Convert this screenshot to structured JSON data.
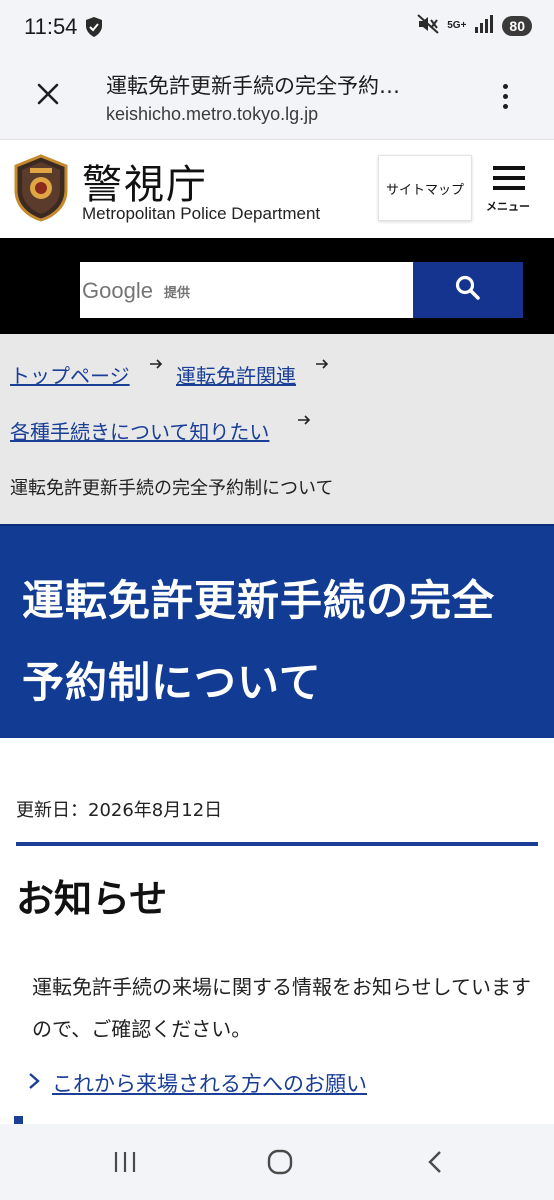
{
  "status_bar": {
    "time": "11:54",
    "network": "5G+",
    "battery": "80",
    "icons": [
      "shield-check-icon",
      "mute-vibrate-icon",
      "signal-icon"
    ]
  },
  "browser": {
    "title": "運転免許更新手続の完全予約…",
    "url": "keishicho.metro.tokyo.lg.jp"
  },
  "site": {
    "name": "警視庁",
    "subtitle": "Metropolitan Police Department",
    "sitemap_label": "サイトマップ",
    "menu_label": "メニュー"
  },
  "search": {
    "provider": "Google",
    "provider_suffix": "提供",
    "button_icon": "search-icon"
  },
  "breadcrumb": {
    "items": [
      {
        "label": "トップページ"
      },
      {
        "label": "運転免許関連"
      },
      {
        "label": "各種手続きについて知りたい"
      }
    ],
    "current": "運転免許更新手続の完全予約制について"
  },
  "page": {
    "title": "運転免許更新手続の完全予約制について",
    "updated": "更新日：2026年8月12日"
  },
  "notice": {
    "heading": "お知らせ",
    "body": "運転免許手続の来場に関する情報をお知らせしていますので、ご確認ください。",
    "link_label": "これから来場される方へのお願い"
  },
  "colors": {
    "brand_blue": "#123b93",
    "link_blue": "#1b3f97",
    "search_button": "#14348f",
    "breadcrumb_bg": "#e8e8e8"
  }
}
